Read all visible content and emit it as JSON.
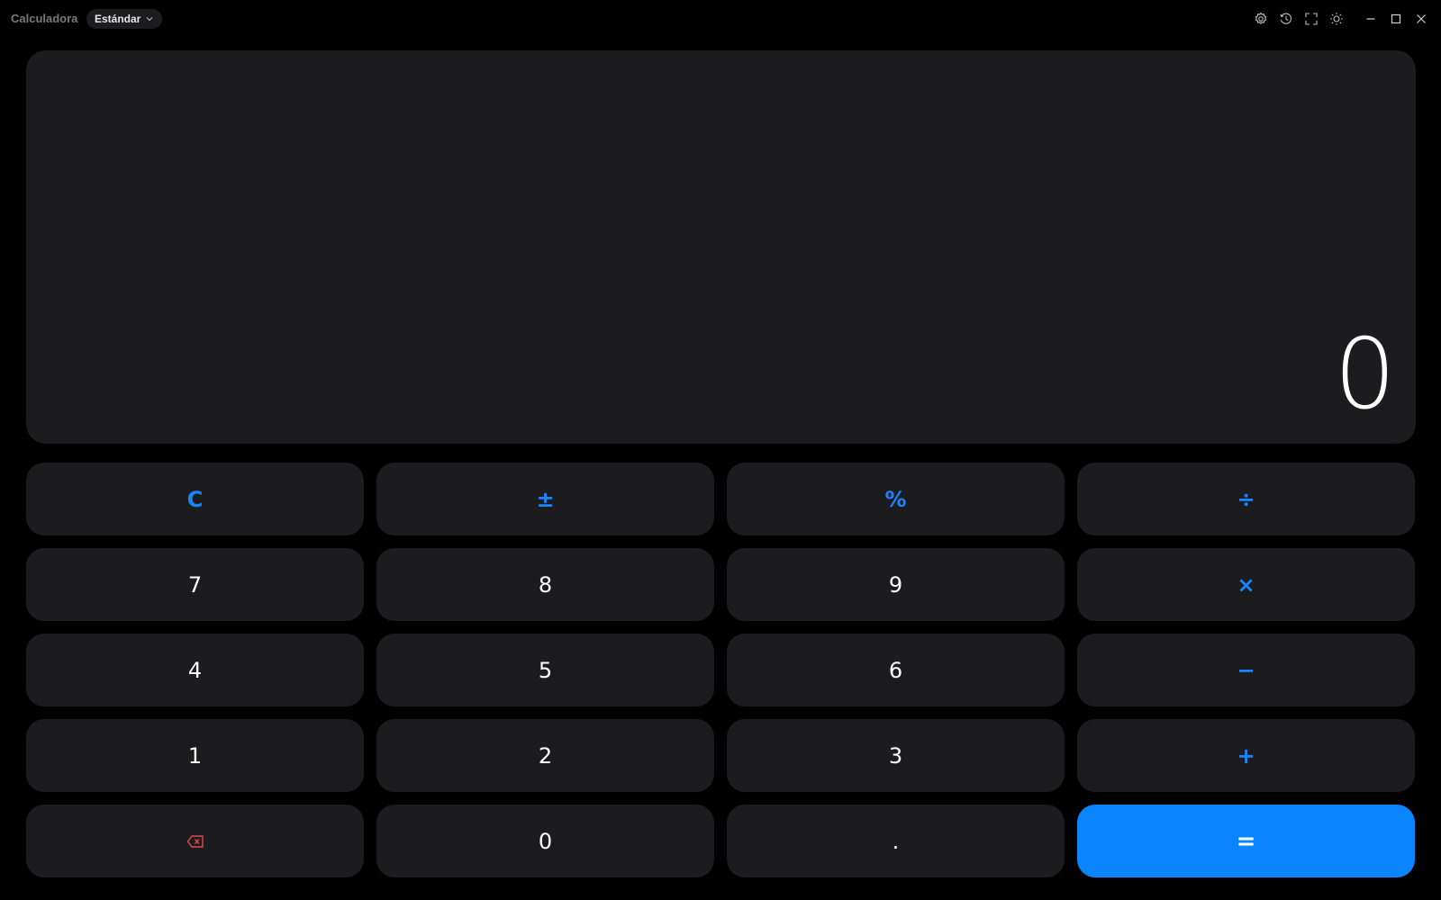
{
  "window": {
    "title": "Calculadora",
    "mode": "Estándar",
    "title_icons": [
      "gear-icon",
      "history-icon",
      "fullscreen-icon",
      "theme-sun-icon",
      "minimize-icon",
      "maximize-icon",
      "close-icon"
    ]
  },
  "display": {
    "value": "0"
  },
  "keypad": {
    "rows": [
      [
        {
          "label": "C",
          "type": "op"
        },
        {
          "label": "±",
          "type": "op"
        },
        {
          "label": "%",
          "type": "op"
        },
        {
          "label": "÷",
          "type": "op"
        }
      ],
      [
        {
          "label": "7",
          "type": "digit"
        },
        {
          "label": "8",
          "type": "digit"
        },
        {
          "label": "9",
          "type": "digit"
        },
        {
          "label": "×",
          "type": "op"
        }
      ],
      [
        {
          "label": "4",
          "type": "digit"
        },
        {
          "label": "5",
          "type": "digit"
        },
        {
          "label": "6",
          "type": "digit"
        },
        {
          "label": "−",
          "type": "op"
        }
      ],
      [
        {
          "label": "1",
          "type": "digit"
        },
        {
          "label": "2",
          "type": "digit"
        },
        {
          "label": "3",
          "type": "digit"
        },
        {
          "label": "+",
          "type": "op"
        }
      ],
      [
        {
          "label": "",
          "type": "backspace",
          "icon": "backspace-icon"
        },
        {
          "label": "0",
          "type": "digit"
        },
        {
          "label": ".",
          "type": "digit"
        },
        {
          "label": "=",
          "type": "equals"
        }
      ]
    ]
  },
  "colors": {
    "background": "#000000",
    "surface": "#1c1c1e",
    "accent": "#0a84ff",
    "operator_text": "#1a84ff",
    "backspace": "#e5484d",
    "text": "#ffffff"
  }
}
